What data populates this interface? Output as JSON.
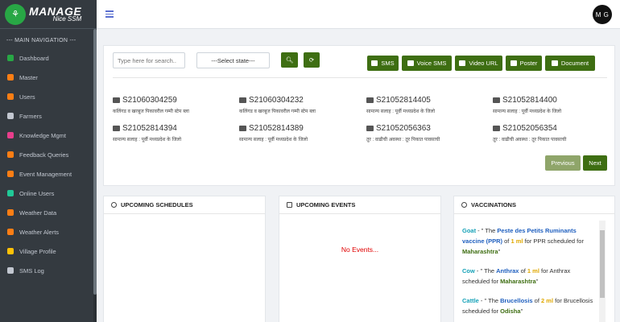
{
  "brand": {
    "title": "MANAGE",
    "subtitle": "Nice SSM"
  },
  "sidebar": {
    "header": "--- MAIN NAVIGATION ---",
    "items": [
      {
        "label": "Dashboard",
        "icon": "home-icon",
        "color": "#28a745"
      },
      {
        "label": "Master",
        "icon": "users-cog-icon",
        "color": "#fd7e14"
      },
      {
        "label": "Users",
        "icon": "user-circle-icon",
        "color": "#fd7e14"
      },
      {
        "label": "Farmers",
        "icon": "tractor-icon",
        "color": "#c2c7d0"
      },
      {
        "label": "Knowledge Mgmt",
        "icon": "book-icon",
        "color": "#e83e8c"
      },
      {
        "label": "Feedback Queries",
        "icon": "comment-icon",
        "color": "#fd7e14"
      },
      {
        "label": "Event Management",
        "icon": "calendar-icon",
        "color": "#fd7e14"
      },
      {
        "label": "Online Users",
        "icon": "globe-icon",
        "color": "#20c997"
      },
      {
        "label": "Weather Data",
        "icon": "cloud-sun-icon",
        "color": "#fd7e14"
      },
      {
        "label": "Weather Alerts",
        "icon": "cloud-icon",
        "color": "#fd7e14"
      },
      {
        "label": "Village Profile",
        "icon": "map-pin-icon",
        "color": "#ffc107"
      },
      {
        "label": "SMS Log",
        "icon": "sms-icon",
        "color": "#c2c7d0"
      }
    ]
  },
  "header": {
    "avatar_initials": "M G"
  },
  "filters": {
    "search_placeholder": "Type here for search..",
    "state_select": "---Select state---"
  },
  "actions": {
    "sms": "SMS",
    "voice_sms": "Voice SMS",
    "video_url": "Video URL",
    "poster": "Poster",
    "document": "Document"
  },
  "messages": [
    {
      "id": "S21060304259",
      "text": "कलिंगड व खरबूज पिकावरील गम्मी स्टेम ब्ला"
    },
    {
      "id": "S21060304232",
      "text": "कलिंगड व खरबूज पिकावरील गम्मी स्टेम ब्ला"
    },
    {
      "id": "S21052814405",
      "text": "सामान्य सलाह : पूर्वी मध्यप्रदेश के जिलो"
    },
    {
      "id": "S21052814400",
      "text": "सामान्य सलाह : पूर्वी मध्यप्रदेश के जिलो"
    },
    {
      "id": "S21052814394",
      "text": "सामान्य सलाह : पूर्वी मध्यप्रदेश के जिलो"
    },
    {
      "id": "S21052814389",
      "text": "सामान्य सलाह : पूर्वी मध्यप्रदेश के जिलो"
    },
    {
      "id": "S21052056363",
      "text": "तूर : वाढीची अवस्था : तूर पिकात पावसाची"
    },
    {
      "id": "S21052056354",
      "text": "तूर : वाढीची अवस्था : तूर पिकात पावसाची"
    }
  ],
  "pagination": {
    "previous": "Previous",
    "next": "Next"
  },
  "panels": {
    "schedules_title": "UPCOMING SCHEDULES",
    "events_title": "UPCOMING EVENTS",
    "no_events": "No Events...",
    "vaccinations_title": "VACCINATIONS"
  },
  "vaccinations": [
    {
      "animal": "Goat",
      "pre": " - \" The ",
      "vaccine": "Peste des Petits Ruminants vaccine (PPR)",
      "of": " of ",
      "dose": "1 ml",
      "post": " for PPR scheduled for ",
      "state": "Maharashtra",
      "end": "\""
    },
    {
      "animal": "Cow",
      "pre": " - \" The ",
      "vaccine": "Anthrax",
      "of": " of ",
      "dose": "1 ml",
      "post": " for Anthrax scheduled for ",
      "state": "Maharashtra",
      "end": "\""
    },
    {
      "animal": "Cattle",
      "pre": " - \" The ",
      "vaccine": "Brucellosis",
      "of": " of ",
      "dose": "2 ml",
      "post": " for Brucellosis scheduled for ",
      "state": "Odisha",
      "end": "\""
    }
  ]
}
